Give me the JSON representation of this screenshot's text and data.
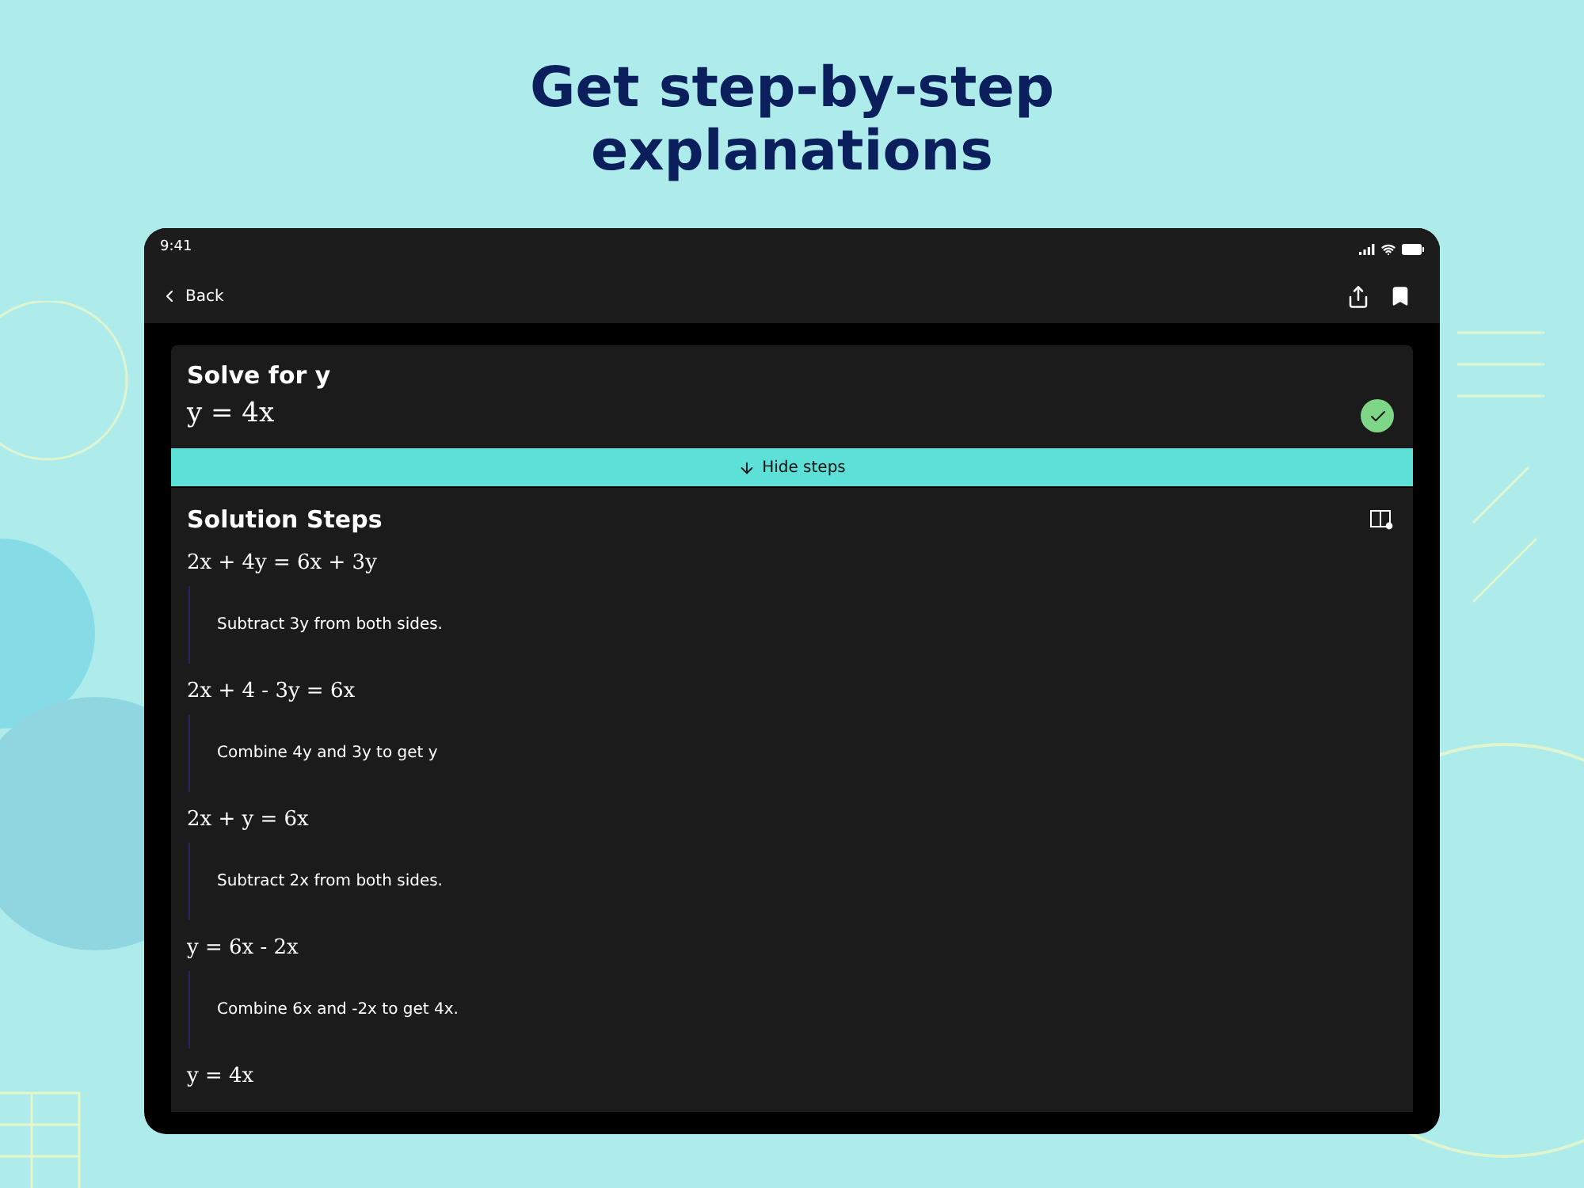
{
  "headline": "Get step-by-step explanations",
  "status_bar": {
    "time": "9:41"
  },
  "nav": {
    "back": "Back"
  },
  "problem": {
    "title": "Solve for y",
    "answer": "y = 4x"
  },
  "toggle": {
    "label": "Hide steps"
  },
  "solution": {
    "title": "Solution Steps",
    "steps": [
      {
        "equation": "2x + 4y = 6x + 3y",
        "explanation": "Subtract 3y from both sides."
      },
      {
        "equation": "2x + 4 - 3y = 6x",
        "explanation": "Combine 4y and 3y to get y"
      },
      {
        "equation": "2x + y = 6x",
        "explanation": "Subtract 2x from both sides."
      },
      {
        "equation": "y = 6x - 2x",
        "explanation": "Combine 6x and -2x to get 4x."
      }
    ],
    "final": "y = 4x"
  }
}
